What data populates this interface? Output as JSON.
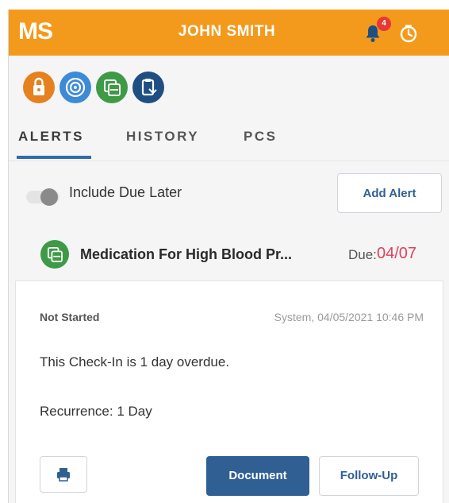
{
  "header": {
    "logo": "MS",
    "user_name": "JOHN SMITH",
    "notification_count": "4",
    "bell_icon": "bell-icon",
    "timer_icon": "timer-icon",
    "bg_color": "#f39a1d"
  },
  "categories": [
    {
      "icon": "lock-bag-icon",
      "color": "#e5821f"
    },
    {
      "icon": "target-icon",
      "color": "#3d8ad6"
    },
    {
      "icon": "pill-box-icon",
      "color": "#3e9a46"
    },
    {
      "icon": "clipboard-icon",
      "color": "#1f4f82"
    }
  ],
  "tabs": [
    {
      "label": "ALERTS",
      "active": true
    },
    {
      "label": "HISTORY",
      "active": false
    },
    {
      "label": "PCS",
      "active": false
    }
  ],
  "filters": {
    "include_due_later_label": "Include Due Later",
    "include_due_later": false,
    "add_alert_label": "Add Alert"
  },
  "alert": {
    "icon": "pill-box-icon",
    "title": "Medication For High Blood Pr...",
    "due_label": "Due:",
    "due_value": "04/07",
    "status": "Not Started",
    "meta": "System, 04/05/2021 10:46 PM",
    "message": "This Check-In is 1 day overdue.",
    "recurrence": "Recurrence: 1 Day",
    "print_icon": "print-icon",
    "document_label": "Document",
    "follow_up_label": "Follow-Up"
  },
  "colors": {
    "accent_blue": "#2f5f93",
    "due_red": "#e0415b"
  }
}
